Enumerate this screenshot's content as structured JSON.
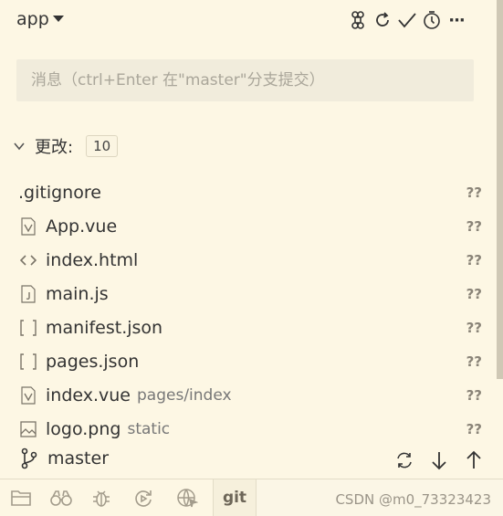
{
  "header": {
    "repo_name": "app"
  },
  "toolbar": {
    "icons": [
      "command-icon",
      "refresh-icon",
      "commit-check-icon",
      "history-icon",
      "more-icon"
    ],
    "more_label": "···"
  },
  "message": {
    "placeholder": "消息（ctrl+Enter 在\"master\"分支提交）",
    "value": ""
  },
  "changes": {
    "label": "更改:",
    "count": "10"
  },
  "files": [
    {
      "name": ".gitignore",
      "dir": "",
      "status": "??",
      "icon": "none"
    },
    {
      "name": "App.vue",
      "dir": "",
      "status": "??",
      "icon": "vue-file-icon"
    },
    {
      "name": "index.html",
      "dir": "",
      "status": "??",
      "icon": "code-icon"
    },
    {
      "name": "main.js",
      "dir": "",
      "status": "??",
      "icon": "js-file-icon"
    },
    {
      "name": "manifest.json",
      "dir": "",
      "status": "??",
      "icon": "json-icon"
    },
    {
      "name": "pages.json",
      "dir": "",
      "status": "??",
      "icon": "json-icon"
    },
    {
      "name": "index.vue",
      "dir": "pages/index",
      "status": "??",
      "icon": "vue-file-icon"
    },
    {
      "name": "logo.png",
      "dir": "static",
      "status": "??",
      "icon": "image-icon"
    }
  ],
  "branch": {
    "name": "master"
  },
  "activity": {
    "git_label": "git"
  },
  "watermark": "CSDN @m0_73323423"
}
